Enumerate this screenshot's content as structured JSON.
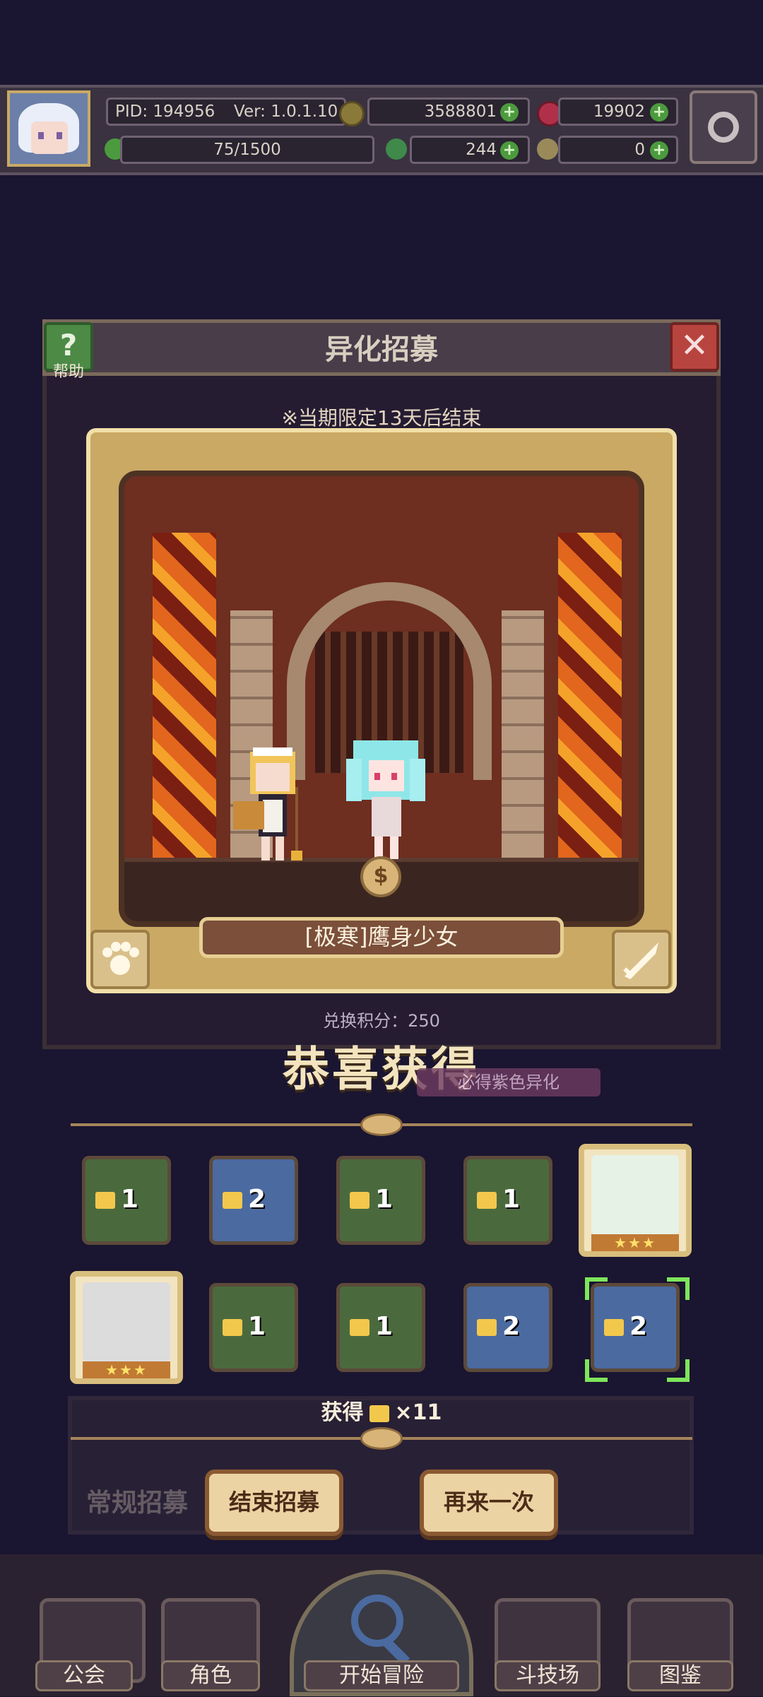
{
  "header": {
    "pid": "PID: 194956",
    "version": "Ver: 1.0.1.10",
    "gold": "3588801",
    "gems": "19902",
    "stamina": "75/1500",
    "clover": "244",
    "key": "0"
  },
  "dialog": {
    "title": "异化招募",
    "help_label": "帮助",
    "close_label": "✕",
    "limited_notice": "※当期限定13天后结束",
    "exchange_points": "兑换积分：250"
  },
  "result": {
    "character_name": "[极寒]鹰身少女",
    "congrats": "恭喜获得",
    "badge": "必得紫色异化",
    "slots_row1": [
      {
        "count": "1",
        "color": "#4a6a3e"
      },
      {
        "count": "2",
        "color": "#4b6aa0"
      },
      {
        "count": "1",
        "color": "#4a6a3e"
      },
      {
        "count": "1",
        "color": "#4a6a3e"
      },
      {
        "count": "",
        "stars": "★★★",
        "color": "#e6f2e6"
      }
    ],
    "slots_row2": [
      {
        "count": "",
        "stars": "★★★",
        "color": "#dcdcdc"
      },
      {
        "count": "1",
        "color": "#4a6a3e"
      },
      {
        "count": "1",
        "color": "#4a6a3e"
      },
      {
        "count": "2",
        "color": "#4b6aa0"
      },
      {
        "count": "2",
        "color": "#4b6aa0"
      }
    ],
    "obtained_prefix": "获得",
    "obtained_count": "×11"
  },
  "banner": {
    "regular_label": "常规招募"
  },
  "buttons": {
    "end_recruit": "结束招募",
    "again": "再来一次"
  },
  "nav": {
    "guild": "公会",
    "character": "角色",
    "adventure": "开始冒险",
    "arena": "斗技场",
    "codex": "图鉴"
  }
}
